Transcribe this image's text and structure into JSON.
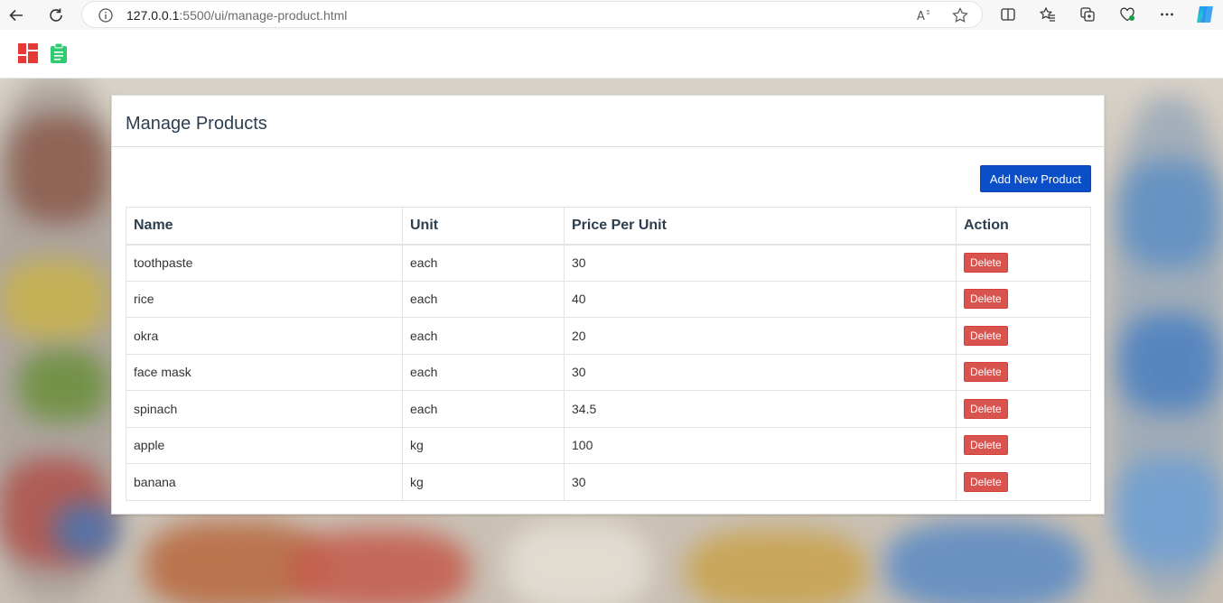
{
  "browser": {
    "url_host": "127.0.0.1",
    "url_path": ":5500/ui/manage-product.html"
  },
  "colors": {
    "primary_button": "#0b4fc8",
    "delete_button": "#d9534f",
    "logo_red": "#e53935",
    "logo_green": "#2ecc71"
  },
  "page": {
    "title": "Manage Products",
    "add_button_label": "Add New Product"
  },
  "table": {
    "headers": [
      "Name",
      "Unit",
      "Price Per Unit",
      "Action"
    ],
    "rows": [
      {
        "name": "toothpaste",
        "unit": "each",
        "price": "30",
        "action": "Delete"
      },
      {
        "name": "rice",
        "unit": "each",
        "price": "40",
        "action": "Delete"
      },
      {
        "name": "okra",
        "unit": "each",
        "price": "20",
        "action": "Delete"
      },
      {
        "name": "face mask",
        "unit": "each",
        "price": "30",
        "action": "Delete"
      },
      {
        "name": "spinach",
        "unit": "each",
        "price": "34.5",
        "action": "Delete"
      },
      {
        "name": "apple",
        "unit": "kg",
        "price": "100",
        "action": "Delete"
      },
      {
        "name": "banana",
        "unit": "kg",
        "price": "30",
        "action": "Delete"
      }
    ]
  }
}
